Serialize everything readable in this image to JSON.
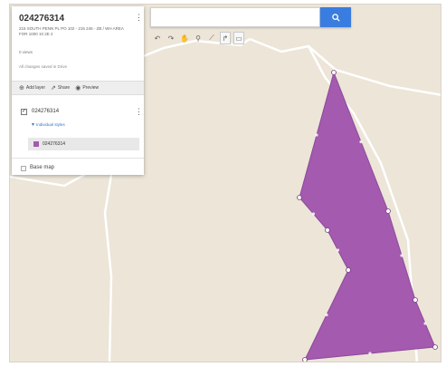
{
  "map": {
    "background_color": "#ece5d8",
    "road_color": "#ffffff",
    "polygon_fill": "#a35aaf",
    "polygon_stroke": "#8e4a9a"
  },
  "search": {
    "placeholder": "",
    "button_icon": "search-icon",
    "button_color": "#3a7de0"
  },
  "toolbar": {
    "tools": [
      {
        "name": "undo-icon",
        "glyph": "↶"
      },
      {
        "name": "redo-icon",
        "glyph": "↷"
      },
      {
        "name": "pan-hand-icon",
        "glyph": "✋"
      },
      {
        "name": "add-marker-icon",
        "glyph": "⚲"
      },
      {
        "name": "draw-line-icon",
        "glyph": "⟋"
      },
      {
        "name": "directions-icon",
        "glyph": "↱"
      },
      {
        "name": "ruler-icon",
        "glyph": "▭"
      }
    ]
  },
  "panel": {
    "title": "024276314",
    "description": "215 SOUTH PENN PL PO 102 - 215 246 - ZB / WH AREA FOR 1000 10 2E 2",
    "views": "0 views",
    "saved": "All changes saved in Drive",
    "actions": {
      "add_layer": "Add layer",
      "share": "Share",
      "preview": "Preview"
    },
    "layer": {
      "checked": "✓",
      "name": "024276314",
      "styles_link": "Individual styles",
      "feature": "024276314"
    },
    "base_map_label": "Base map"
  }
}
